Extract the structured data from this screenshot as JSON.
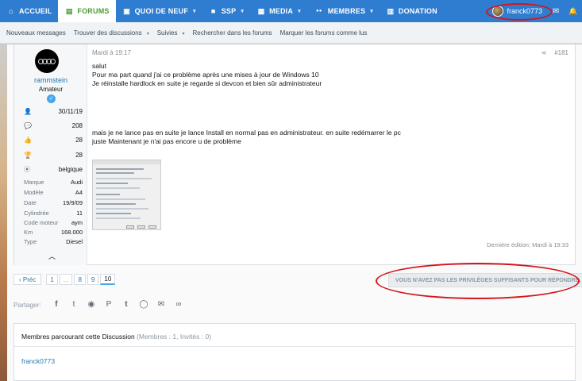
{
  "topnav": {
    "items": [
      {
        "label": "ACCUEIL",
        "icon": "home-icon",
        "glyph": "⌂"
      },
      {
        "label": "FORUMS",
        "icon": "forum-icon",
        "glyph": "▤"
      },
      {
        "label": "QUOI DE NEUF",
        "icon": "news-icon",
        "glyph": "▣"
      },
      {
        "label": "SSP",
        "icon": "folder-icon",
        "glyph": "■"
      },
      {
        "label": "MEDIA",
        "icon": "media-icon",
        "glyph": "▦"
      },
      {
        "label": "MEMBRES",
        "icon": "members-icon",
        "glyph": "●●"
      },
      {
        "label": "DONATION",
        "icon": "gift-icon",
        "glyph": "▥"
      }
    ],
    "username": "franck0773",
    "caret": "▾",
    "mail_glyph": "✉",
    "bell_glyph": "🔔"
  },
  "subnav": {
    "items": [
      "Nouveaux messages",
      "Trouver des discussions",
      "Suivies",
      "Rechercher dans les forums",
      "Marquer les forums comme lus"
    ],
    "caret": "▾"
  },
  "post": {
    "author": "rammstein",
    "author_title": "Amateur",
    "badge": "✓",
    "stats": [
      {
        "icon": "user-icon",
        "glyph": "👤",
        "value": "30/11/19"
      },
      {
        "icon": "messages-icon",
        "glyph": "💬",
        "value": "208"
      },
      {
        "icon": "thumbs-up-icon",
        "glyph": "👍",
        "value": "28"
      },
      {
        "icon": "trophy-icon",
        "glyph": "🏆",
        "value": "28"
      },
      {
        "icon": "location-icon",
        "glyph": "⦿",
        "value": "belgique"
      }
    ],
    "extra": [
      {
        "label": "Marque",
        "value": "Audi"
      },
      {
        "label": "Modèle",
        "value": "A4"
      },
      {
        "label": "Date",
        "value": "19/9/09"
      },
      {
        "label": "Cylindrée",
        "value": "11"
      },
      {
        "label": "Code moteur",
        "value": "aym"
      },
      {
        "label": "Km",
        "value": "168.000"
      },
      {
        "label": "Type",
        "value": "Diesel"
      }
    ],
    "collapse_glyph": "︿",
    "date": "Mardi à 19:17",
    "number": "#181",
    "share_glyph": "⋖",
    "body": {
      "line1": "salut",
      "line2": "Pour ma part quand j'ai ce problème après une mises à jour de Windows 10",
      "line3": "Je réinstalle hardlock en suite je regarde si devcon et bien sûr administrateur",
      "line4": "mais je ne lance pas en suite je lance Install en normal pas en administrateur. en suite redémarrer le pc",
      "line5": "juste Maintenant je n'ai pas encore u de problème"
    },
    "last_edit": "Dernière édition: Mardi à 19:33"
  },
  "pager": {
    "prev": "‹ Préc",
    "pages": [
      "1",
      "...",
      "8",
      "9",
      "10"
    ]
  },
  "no_privileges": "VOUS N'AVEZ PAS LES PRIVILÈGES SUFFISANTS POUR RÉPONDRE.",
  "share": {
    "label": "Partager:",
    "icons": [
      {
        "name": "facebook-icon",
        "glyph": "f"
      },
      {
        "name": "twitter-icon",
        "glyph": "t"
      },
      {
        "name": "reddit-icon",
        "glyph": "◉"
      },
      {
        "name": "pinterest-icon",
        "glyph": "P"
      },
      {
        "name": "tumblr-icon",
        "glyph": "t"
      },
      {
        "name": "whatsapp-icon",
        "glyph": "◯"
      },
      {
        "name": "email-icon",
        "glyph": "✉"
      },
      {
        "name": "link-icon",
        "glyph": "∞"
      }
    ]
  },
  "members": {
    "title": "Membres parcourant cette Discussion",
    "count": "(Membres : 1, Invités : 0)",
    "user": "franck0773"
  },
  "colors": {
    "nav_blue": "#2e7dd1",
    "active_green": "#4a9e2f",
    "link_blue": "#2577b1",
    "annotation_red": "#d4141b"
  }
}
